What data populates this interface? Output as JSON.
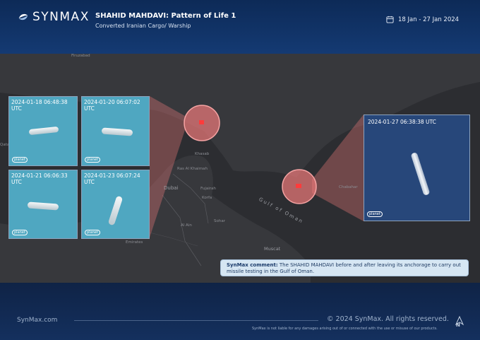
{
  "brand": {
    "name": "SYNMAX",
    "site": "SynMax.com"
  },
  "header": {
    "title": "SHAHID MAHDAVI: Pattern of Life 1",
    "subtitle": "Converted Iranian Cargo/ Warship",
    "date_range": "18 Jan - 27 Jan 2024"
  },
  "images": [
    {
      "timestamp": "2024-01-18 06:48:38\nUTC",
      "credit": "planet"
    },
    {
      "timestamp": "2024-01-20 06:07:02\nUTC",
      "credit": "planet"
    },
    {
      "timestamp": "2024-01-21 06:06:33\nUTC",
      "credit": "planet"
    },
    {
      "timestamp": "2024-01-23 06:07:24\nUTC",
      "credit": "planet"
    },
    {
      "timestamp": "2024-01-27 06:38:38 UTC",
      "credit": "planet"
    }
  ],
  "map_labels": {
    "firuzabad": "Firuzabad",
    "khasab": "Khasab",
    "ras_al_khaimah": "Ras Al Khaimah",
    "dubai": "Dubai",
    "fujairah": "Fujairah",
    "korfa": "Korfa",
    "sohar": "Sohar",
    "al_ain": "Al Ain",
    "emirates": "Emirates",
    "muscat": "Muscat",
    "chabahar": "Chabahar",
    "gulf_of_oman": "Gulf of Oman",
    "edge_label": "Qatar"
  },
  "comment": {
    "label": "SynMax comment:",
    "text": "The SHAHID MAHDAVI before and after leaving its anchorage to carry out missile testing in the Gulf of Oman."
  },
  "footer": {
    "copyright": "© 2024 SynMax. All rights reserved.",
    "disclaimer": "SynMax is not liable for any damages arising out of or connected with the use or misuse of our products.",
    "north": "N"
  },
  "colors": {
    "header_bg": "#143a73",
    "map_bg": "#2c2d31",
    "highlight": "#f07b7b",
    "marker": "#ff3b3b",
    "water": "#4fa7c1"
  }
}
